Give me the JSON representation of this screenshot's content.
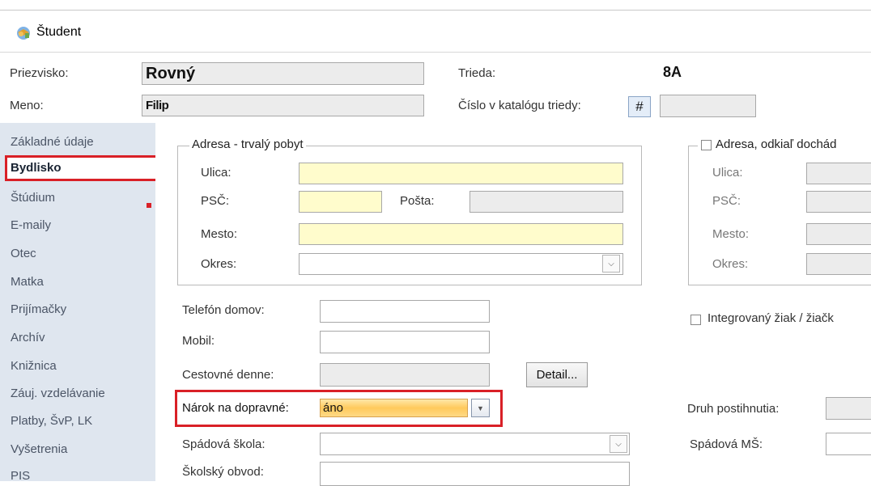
{
  "window": {
    "title": "Študent",
    "icon": "student-icon"
  },
  "header": {
    "surname_label": "Priezvisko:",
    "surname_value": "Rovný",
    "name_label": "Meno:",
    "name_value": "Filip",
    "class_label": "Trieda:",
    "class_value": "8A",
    "catalog_label": "Číslo v katalógu triedy:",
    "catalog_button": "#",
    "catalog_value": ""
  },
  "sidebar": {
    "items": [
      {
        "label": "Základné údaje"
      },
      {
        "label": "Bydlisko",
        "active": true
      },
      {
        "label": "Štúdium"
      },
      {
        "label": "E-maily"
      },
      {
        "label": "Otec"
      },
      {
        "label": "Matka"
      },
      {
        "label": "Prijímačky"
      },
      {
        "label": "Archív"
      },
      {
        "label": "Knižnica"
      },
      {
        "label": "Záuj. vzdelávanie"
      },
      {
        "label": "Platby, ŠvP, LK"
      },
      {
        "label": "Vyšetrenia"
      },
      {
        "label": "PIS"
      }
    ]
  },
  "permanent_address": {
    "legend": "Adresa - trvalý pobyt",
    "street_label": "Ulica:",
    "street_value": "",
    "zip_label": "PSČ:",
    "zip_value": "",
    "post_label": "Pošta:",
    "post_value": "",
    "city_label": "Mesto:",
    "city_value": "",
    "district_label": "Okres:",
    "district_value": ""
  },
  "commute_address": {
    "legend": "Adresa, odkiaľ dochád",
    "checked": false,
    "street_label": "Ulica:",
    "zip_label": "PSČ:",
    "city_label": "Mesto:",
    "district_label": "Okres:"
  },
  "contact": {
    "phone_home_label": "Telefón domov:",
    "phone_home_value": "",
    "mobile_label": "Mobil:",
    "mobile_value": "",
    "commute_daily_label": "Cestovné denne:",
    "commute_daily_value": "",
    "detail_button": "Detail...",
    "transport_claim_label": "Nárok na dopravné:",
    "transport_claim_value": "áno",
    "catchment_school_label": "Spádová škola:",
    "catchment_school_value": "",
    "school_district_label": "Školský obvod:",
    "school_district_value": ""
  },
  "right": {
    "integrated_label": "Integrovaný žiak / žiačk",
    "integrated_checked": false,
    "disability_label": "Druh postihnutia:",
    "disability_value": "",
    "catchment_ms_label": "Spádová MŠ:",
    "catchment_ms_value": ""
  },
  "colors": {
    "highlight": "#d92027",
    "sidebar_bg": "#dfe6ef",
    "required_field": "#fffccc",
    "combo_selected": "#ffca5c"
  }
}
